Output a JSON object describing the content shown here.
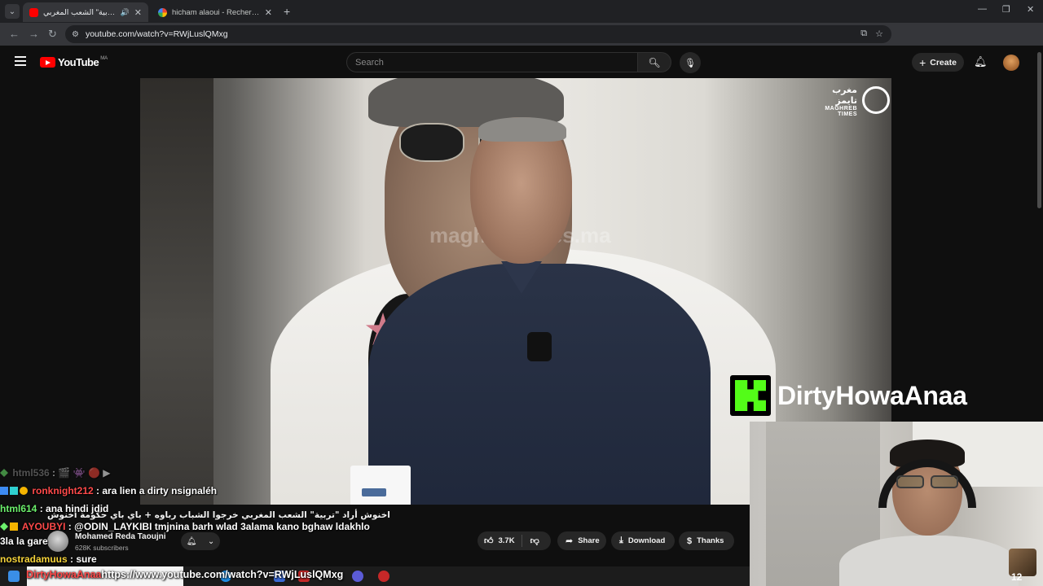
{
  "browser": {
    "tabs": [
      {
        "title": "اخنوش أراد \"تربية\" الشعب المغربي",
        "active": true
      },
      {
        "title": "hicham alaoui - Recherche Goo",
        "active": false
      }
    ],
    "url": "youtube.com/watch?v=RWjLuslQMxg"
  },
  "youtube": {
    "logo_text": "YouTube",
    "country_code": "MA",
    "search_placeholder": "Search",
    "create_label": "Create"
  },
  "video": {
    "channel_logo_ar": "مغرب تايمز",
    "channel_logo_en": "MAGHREB TIMES",
    "watermark": "maghrebtimes.ma",
    "title_ar": "اخنوش أراد \"تربية\" الشعب المغربي خرجوا الشباب رباوه + باي باي حكومة اخنوش",
    "channel_name": "Mohamed Reda Taoujni",
    "subscribers": "628K subscribers",
    "likes": "3.7K",
    "share_label": "Share",
    "download_label": "Download",
    "thanks_label": "Thanks"
  },
  "stream": {
    "streamer_name": "DirtyHowaAnaa",
    "platform_icon": "kick-icon",
    "chat": [
      {
        "user": "html536",
        "text": "",
        "color": "#8a8a8a"
      },
      {
        "user": "ronknight212",
        "text": "ara lien a dirty nsignaléh",
        "color": "#ff4a4a"
      },
      {
        "user": "html614",
        "text": "ana hindi jdid",
        "color": "#6cf06c"
      },
      {
        "user": "AYOUBYI",
        "text": "@ODIN_LAYKIBI tmjnina barh wlad 3alama kano bghaw ldakhlo",
        "color": "#ff4a4a"
      },
      {
        "user": "",
        "text": "3la la gare",
        "color": "#ffffff"
      },
      {
        "user": "nostradamuus",
        "text": "sure",
        "color": "#f5d33a"
      }
    ],
    "overlay_url_user": "DirtyHowaAnaa",
    "overlay_url": "https://www.youtube.com/watch?v=RWjLuslQMxg",
    "webcam_badge": "12"
  }
}
